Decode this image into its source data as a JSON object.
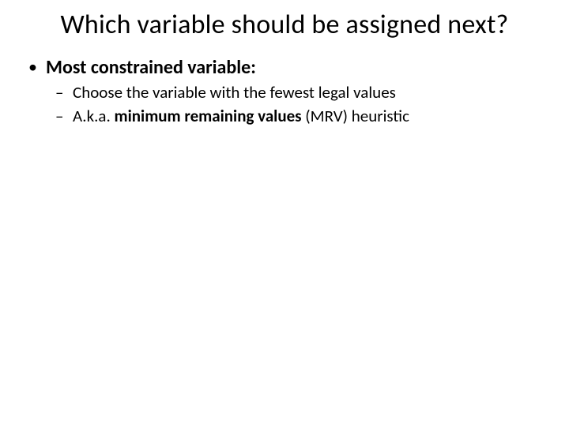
{
  "title": "Which variable should be assigned next?",
  "bullets": {
    "l1": "Most constrained variable:",
    "l2a": "Choose the variable with the fewest legal values",
    "l2b_prefix": "A.k.a. ",
    "l2b_bold": "minimum remaining values",
    "l2b_suffix": " (MRV) heuristic"
  }
}
